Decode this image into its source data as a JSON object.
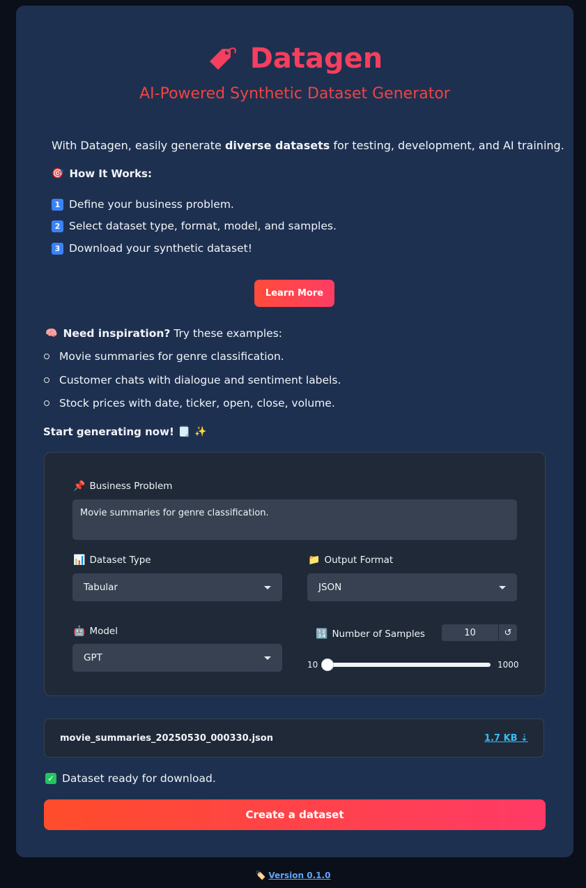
{
  "header": {
    "title": "Datagen",
    "subtitle": "AI-Powered Synthetic Dataset Generator",
    "brand_color": "#f43f5e",
    "icon": "tag-icon"
  },
  "intro": {
    "prefix": "With Datagen, easily generate ",
    "bold": "diverse datasets",
    "suffix": " for testing, development, and AI training."
  },
  "how_it_works": {
    "heading": "How It Works:",
    "steps": [
      {
        "num": "1",
        "text": "Define your business problem."
      },
      {
        "num": "2",
        "text": "Select dataset type, format, model, and samples."
      },
      {
        "num": "3",
        "text": "Download your synthetic dataset!"
      }
    ]
  },
  "learn_more_label": "Learn More",
  "inspiration": {
    "bold": "Need inspiration?",
    "rest": " Try these examples:",
    "examples": [
      "Movie summaries for genre classification.",
      "Customer chats with dialogue and sentiment labels.",
      "Stock prices with date, ticker, open, close, volume."
    ]
  },
  "start_text": "Start generating now!",
  "form": {
    "business_problem_label": "Business Problem",
    "business_problem_value": "Movie summaries for genre classification.",
    "dataset_type_label": "Dataset Type",
    "dataset_type_value": "Tabular",
    "output_format_label": "Output Format",
    "output_format_value": "JSON",
    "model_label": "Model",
    "model_value": "GPT",
    "samples_label": "Number of Samples",
    "samples_value": "10",
    "slider_min": "10",
    "slider_max": "1000",
    "slider_fraction": 0.0
  },
  "file": {
    "name": "movie_summaries_20250530_000330.json",
    "size": "1.7 KB ⇣"
  },
  "status": "Dataset ready for download.",
  "create_label": "Create a dataset",
  "footer": {
    "version": "Version 0.1.0"
  }
}
